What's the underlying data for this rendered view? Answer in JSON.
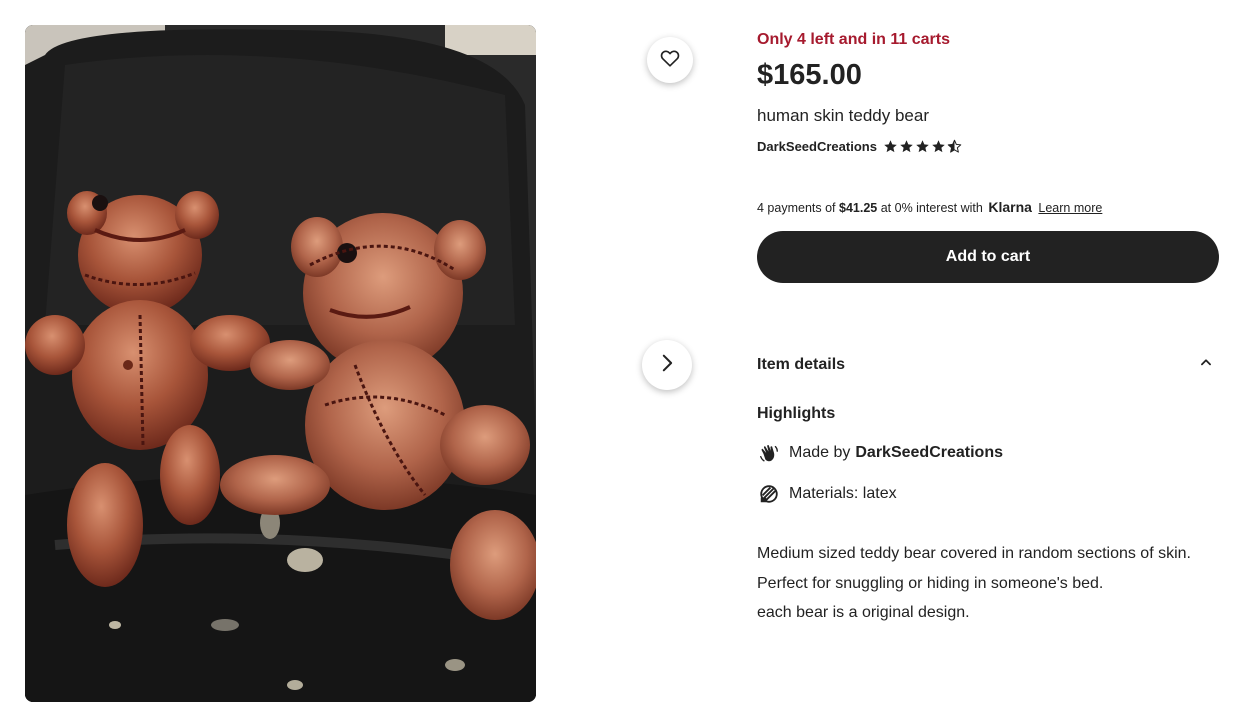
{
  "listing": {
    "stock_notice": "Only 4 left and in 11 carts",
    "price": "$165.00",
    "title": "human skin teddy bear",
    "shop_name": "DarkSeedCreations",
    "rating": 4.5,
    "payments": {
      "prefix": "4 payments of",
      "amount": "$41.25",
      "middle": "at 0% interest with",
      "provider": "Klarna",
      "link": "Learn more"
    },
    "add_to_cart": "Add to cart"
  },
  "item_details": {
    "header": "Item details",
    "highlights_title": "Highlights",
    "made_by_label": "Made by",
    "made_by_name": "DarkSeedCreations",
    "materials": "Materials: latex",
    "description_lines": [
      "Medium sized teddy bear covered in random sections of skin. Perfect for snuggling or hiding in someone's bed.",
      "each bear is a original design."
    ]
  },
  "icons": {
    "favorite": "heart-icon",
    "next": "chevron-right-icon",
    "collapse": "chevron-up-icon",
    "made_by": "hand-wave-icon",
    "materials": "materials-icon"
  },
  "colors": {
    "stock_notice": "#a61a2e",
    "cart_button": "#222222",
    "text": "#222222"
  }
}
